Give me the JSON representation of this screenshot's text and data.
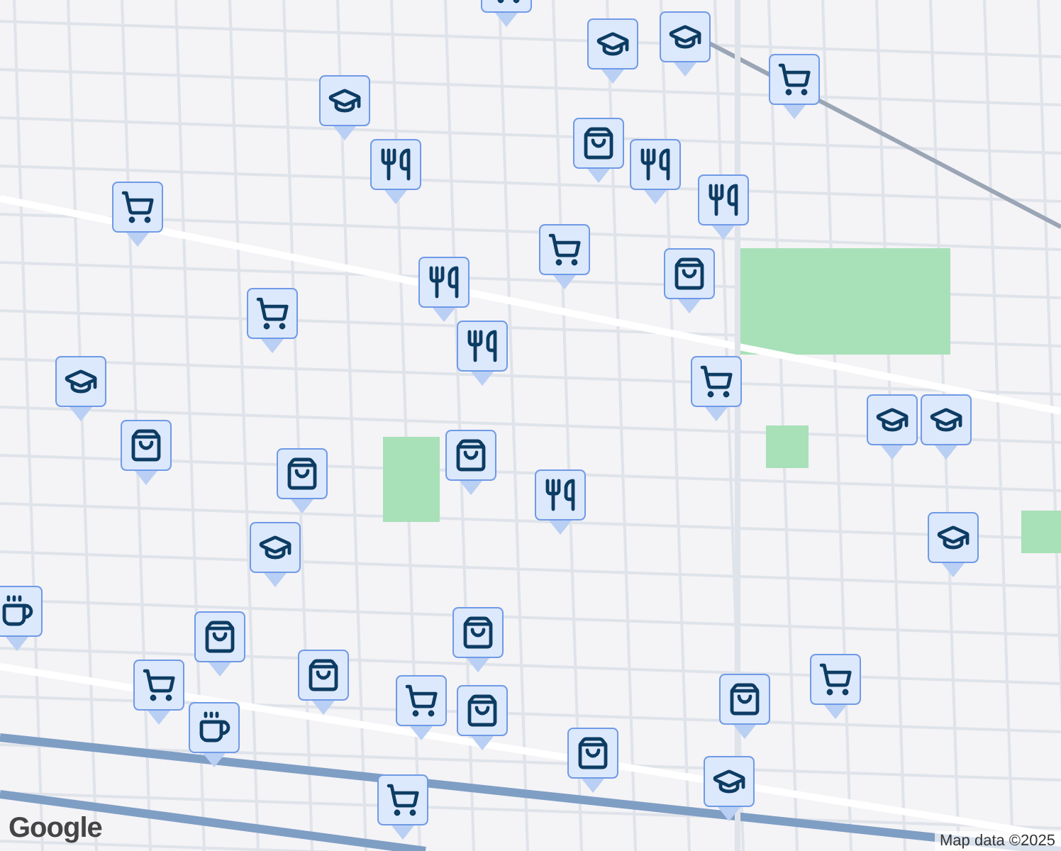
{
  "map": {
    "pins": [
      {
        "kind": "cart"
      },
      {
        "kind": "school"
      },
      {
        "kind": "school"
      },
      {
        "kind": "cart"
      },
      {
        "kind": "school"
      },
      {
        "kind": "bag"
      },
      {
        "kind": "restaurant"
      },
      {
        "kind": "cart"
      },
      {
        "kind": "restaurant"
      },
      {
        "kind": "restaurant"
      },
      {
        "kind": "cart"
      },
      {
        "kind": "bag"
      },
      {
        "kind": "restaurant"
      },
      {
        "kind": "cart"
      },
      {
        "kind": "restaurant"
      },
      {
        "kind": "cart"
      },
      {
        "kind": "school"
      },
      {
        "kind": "bag"
      },
      {
        "kind": "school"
      },
      {
        "kind": "school"
      },
      {
        "kind": "bag"
      },
      {
        "kind": "bag"
      },
      {
        "kind": "restaurant"
      },
      {
        "kind": "school"
      },
      {
        "kind": "school"
      },
      {
        "kind": "cafe"
      },
      {
        "kind": "bag"
      },
      {
        "kind": "bag"
      },
      {
        "kind": "cart"
      },
      {
        "kind": "bag"
      },
      {
        "kind": "bag"
      },
      {
        "kind": "cart"
      },
      {
        "kind": "cart"
      },
      {
        "kind": "bag"
      },
      {
        "kind": "cafe"
      },
      {
        "kind": "bag"
      },
      {
        "kind": "school"
      },
      {
        "kind": "cart"
      }
    ]
  },
  "logo": "Google",
  "attribution": "Map data ©2025"
}
